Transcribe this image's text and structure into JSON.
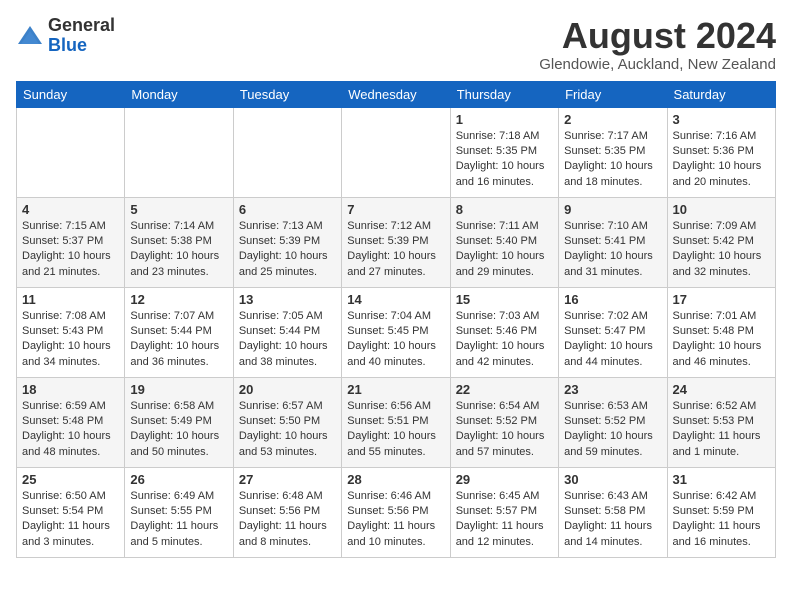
{
  "header": {
    "logo": {
      "line1": "General",
      "line2": "Blue"
    },
    "title": "August 2024",
    "location": "Glendowie, Auckland, New Zealand"
  },
  "weekdays": [
    "Sunday",
    "Monday",
    "Tuesday",
    "Wednesday",
    "Thursday",
    "Friday",
    "Saturday"
  ],
  "weeks": [
    [
      {
        "day": "",
        "info": ""
      },
      {
        "day": "",
        "info": ""
      },
      {
        "day": "",
        "info": ""
      },
      {
        "day": "",
        "info": ""
      },
      {
        "day": "1",
        "info": "Sunrise: 7:18 AM\nSunset: 5:35 PM\nDaylight: 10 hours\nand 16 minutes."
      },
      {
        "day": "2",
        "info": "Sunrise: 7:17 AM\nSunset: 5:35 PM\nDaylight: 10 hours\nand 18 minutes."
      },
      {
        "day": "3",
        "info": "Sunrise: 7:16 AM\nSunset: 5:36 PM\nDaylight: 10 hours\nand 20 minutes."
      }
    ],
    [
      {
        "day": "4",
        "info": "Sunrise: 7:15 AM\nSunset: 5:37 PM\nDaylight: 10 hours\nand 21 minutes."
      },
      {
        "day": "5",
        "info": "Sunrise: 7:14 AM\nSunset: 5:38 PM\nDaylight: 10 hours\nand 23 minutes."
      },
      {
        "day": "6",
        "info": "Sunrise: 7:13 AM\nSunset: 5:39 PM\nDaylight: 10 hours\nand 25 minutes."
      },
      {
        "day": "7",
        "info": "Sunrise: 7:12 AM\nSunset: 5:39 PM\nDaylight: 10 hours\nand 27 minutes."
      },
      {
        "day": "8",
        "info": "Sunrise: 7:11 AM\nSunset: 5:40 PM\nDaylight: 10 hours\nand 29 minutes."
      },
      {
        "day": "9",
        "info": "Sunrise: 7:10 AM\nSunset: 5:41 PM\nDaylight: 10 hours\nand 31 minutes."
      },
      {
        "day": "10",
        "info": "Sunrise: 7:09 AM\nSunset: 5:42 PM\nDaylight: 10 hours\nand 32 minutes."
      }
    ],
    [
      {
        "day": "11",
        "info": "Sunrise: 7:08 AM\nSunset: 5:43 PM\nDaylight: 10 hours\nand 34 minutes."
      },
      {
        "day": "12",
        "info": "Sunrise: 7:07 AM\nSunset: 5:44 PM\nDaylight: 10 hours\nand 36 minutes."
      },
      {
        "day": "13",
        "info": "Sunrise: 7:05 AM\nSunset: 5:44 PM\nDaylight: 10 hours\nand 38 minutes."
      },
      {
        "day": "14",
        "info": "Sunrise: 7:04 AM\nSunset: 5:45 PM\nDaylight: 10 hours\nand 40 minutes."
      },
      {
        "day": "15",
        "info": "Sunrise: 7:03 AM\nSunset: 5:46 PM\nDaylight: 10 hours\nand 42 minutes."
      },
      {
        "day": "16",
        "info": "Sunrise: 7:02 AM\nSunset: 5:47 PM\nDaylight: 10 hours\nand 44 minutes."
      },
      {
        "day": "17",
        "info": "Sunrise: 7:01 AM\nSunset: 5:48 PM\nDaylight: 10 hours\nand 46 minutes."
      }
    ],
    [
      {
        "day": "18",
        "info": "Sunrise: 6:59 AM\nSunset: 5:48 PM\nDaylight: 10 hours\nand 48 minutes."
      },
      {
        "day": "19",
        "info": "Sunrise: 6:58 AM\nSunset: 5:49 PM\nDaylight: 10 hours\nand 50 minutes."
      },
      {
        "day": "20",
        "info": "Sunrise: 6:57 AM\nSunset: 5:50 PM\nDaylight: 10 hours\nand 53 minutes."
      },
      {
        "day": "21",
        "info": "Sunrise: 6:56 AM\nSunset: 5:51 PM\nDaylight: 10 hours\nand 55 minutes."
      },
      {
        "day": "22",
        "info": "Sunrise: 6:54 AM\nSunset: 5:52 PM\nDaylight: 10 hours\nand 57 minutes."
      },
      {
        "day": "23",
        "info": "Sunrise: 6:53 AM\nSunset: 5:52 PM\nDaylight: 10 hours\nand 59 minutes."
      },
      {
        "day": "24",
        "info": "Sunrise: 6:52 AM\nSunset: 5:53 PM\nDaylight: 11 hours\nand 1 minute."
      }
    ],
    [
      {
        "day": "25",
        "info": "Sunrise: 6:50 AM\nSunset: 5:54 PM\nDaylight: 11 hours\nand 3 minutes."
      },
      {
        "day": "26",
        "info": "Sunrise: 6:49 AM\nSunset: 5:55 PM\nDaylight: 11 hours\nand 5 minutes."
      },
      {
        "day": "27",
        "info": "Sunrise: 6:48 AM\nSunset: 5:56 PM\nDaylight: 11 hours\nand 8 minutes."
      },
      {
        "day": "28",
        "info": "Sunrise: 6:46 AM\nSunset: 5:56 PM\nDaylight: 11 hours\nand 10 minutes."
      },
      {
        "day": "29",
        "info": "Sunrise: 6:45 AM\nSunset: 5:57 PM\nDaylight: 11 hours\nand 12 minutes."
      },
      {
        "day": "30",
        "info": "Sunrise: 6:43 AM\nSunset: 5:58 PM\nDaylight: 11 hours\nand 14 minutes."
      },
      {
        "day": "31",
        "info": "Sunrise: 6:42 AM\nSunset: 5:59 PM\nDaylight: 11 hours\nand 16 minutes."
      }
    ]
  ]
}
